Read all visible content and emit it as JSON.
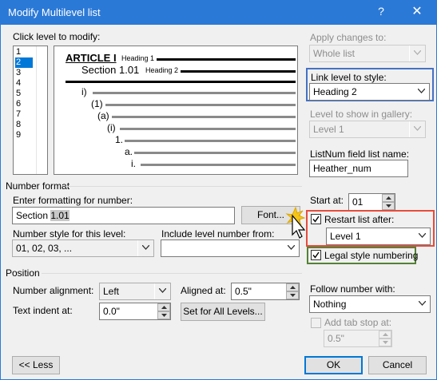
{
  "window": {
    "title": "Modify Multilevel list",
    "help_glyph": "?",
    "close_glyph": "✕"
  },
  "click_level": {
    "label": "Click level to modify:",
    "levels": [
      "1",
      "2",
      "3",
      "4",
      "5",
      "6",
      "7",
      "8",
      "9"
    ],
    "selected": "2"
  },
  "preview": {
    "article": "ARTICLE I",
    "article_style": "Heading 1",
    "section": "Section 1.01",
    "section_style": "Heading 2",
    "sublevels": [
      "i)",
      "(1)",
      "(a)",
      "(i)",
      "1.",
      "a.",
      "i."
    ]
  },
  "apply_changes": {
    "label": "Apply changes to:",
    "value": "Whole list"
  },
  "link_level": {
    "label": "Link level to style:",
    "value": "Heading 2"
  },
  "gallery_level": {
    "label": "Level to show in gallery:",
    "value": "Level 1"
  },
  "listnum": {
    "label": "ListNum field list name:",
    "value": "Heather_num"
  },
  "number_format": {
    "group_label": "Number format",
    "enter_label": "Enter formatting for number:",
    "format_prefix": "Section ",
    "format_field": "1.01",
    "font_button": "Font...",
    "style_label": "Number style for this level:",
    "style_value": "01, 02, 03, ...",
    "include_label": "Include level number from:",
    "include_value": ""
  },
  "start_at": {
    "label": "Start at:",
    "value": "01"
  },
  "restart": {
    "label": "Restart list after:",
    "checked": true,
    "value": "Level 1"
  },
  "legal": {
    "label": "Legal style numbering",
    "checked": true
  },
  "position": {
    "group_label": "Position",
    "alignment_label": "Number alignment:",
    "alignment_value": "Left",
    "aligned_at_label": "Aligned at:",
    "aligned_at_value": "0.5\"",
    "indent_label": "Text indent at:",
    "indent_value": "0.0\"",
    "set_all_button": "Set for All Levels...",
    "follow_label": "Follow number with:",
    "follow_value": "Nothing",
    "tab_stop_label": "Add tab stop at:",
    "tab_stop_checked": false,
    "tab_stop_value": "0.5\""
  },
  "buttons": {
    "less": "<< Less",
    "ok": "OK",
    "cancel": "Cancel"
  },
  "colors": {
    "titlebar": "#2b79d7",
    "selection": "#0078d7",
    "highlight_blue": "#4472c4",
    "highlight_red": "#e74c3c",
    "highlight_green": "#548235"
  }
}
